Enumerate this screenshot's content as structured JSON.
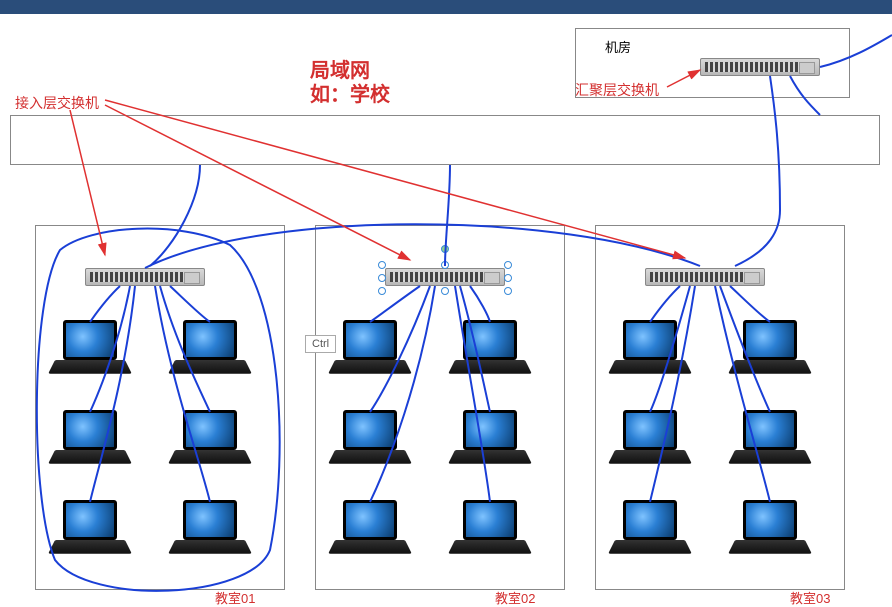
{
  "title": {
    "line1": "局域网",
    "line2": "如：学校"
  },
  "labels": {
    "access_switch": "接入层交换机",
    "aggregation_switch": "汇聚层交换机",
    "server_room": "机房",
    "ctrl": "Ctrl"
  },
  "classrooms": [
    {
      "id": "classroom-01",
      "label": "教室01"
    },
    {
      "id": "classroom-02",
      "label": "教室02"
    },
    {
      "id": "classroom-03",
      "label": "教室03"
    }
  ],
  "topology": {
    "type": "lan",
    "layers": [
      "aggregation",
      "access",
      "endpoint"
    ],
    "aggregation_switch_count": 1,
    "access_switch_count": 3,
    "laptops_per_classroom": 6
  },
  "colors": {
    "cable": "#1a3fd6",
    "arrow": "#e03131",
    "label_red": "#d32f2f"
  }
}
